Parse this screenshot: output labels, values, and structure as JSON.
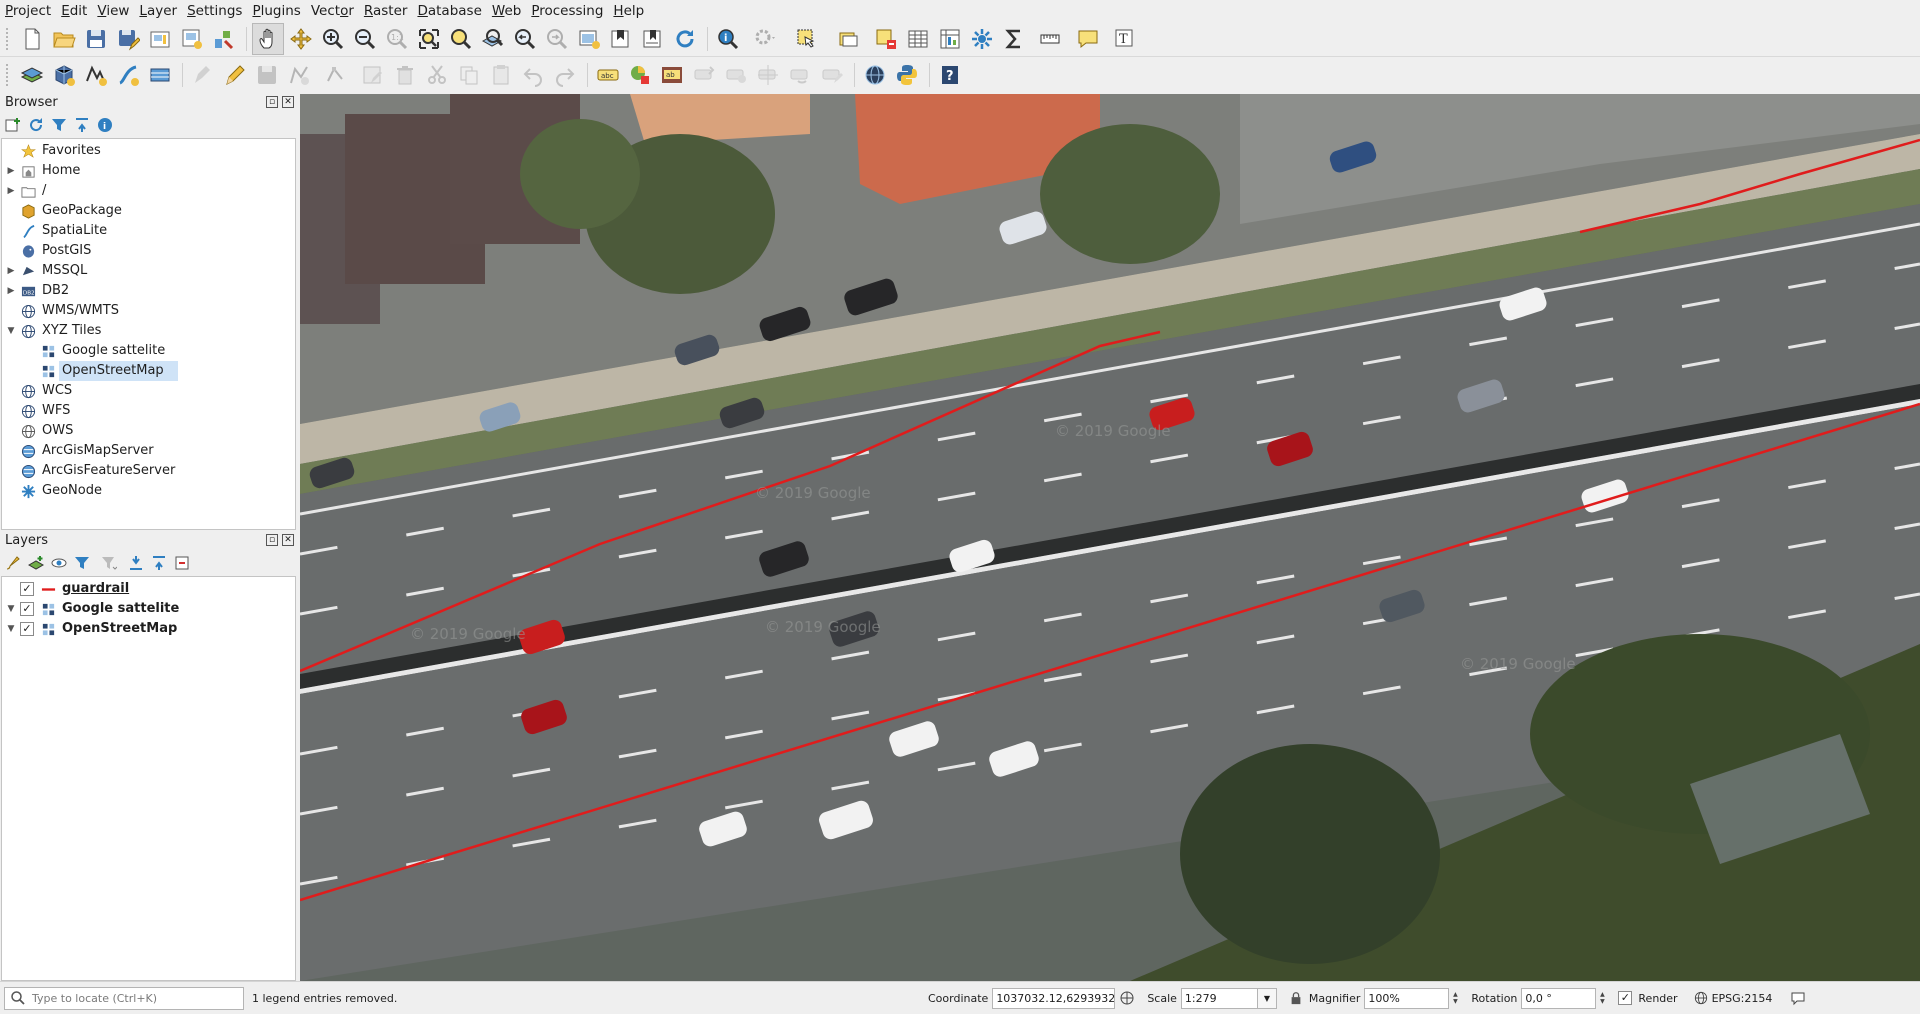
{
  "menu": [
    {
      "label": "Project",
      "key": "P"
    },
    {
      "label": "Edit",
      "key": "E"
    },
    {
      "label": "View",
      "key": "V"
    },
    {
      "label": "Layer",
      "key": "L"
    },
    {
      "label": "Settings",
      "key": "S"
    },
    {
      "label": "Plugins",
      "key": "P"
    },
    {
      "label": "Vector",
      "key": "o"
    },
    {
      "label": "Raster",
      "key": "R"
    },
    {
      "label": "Database",
      "key": "D"
    },
    {
      "label": "Web",
      "key": "W"
    },
    {
      "label": "Processing",
      "key": "P"
    },
    {
      "label": "Help",
      "key": "H"
    }
  ],
  "toolbar1": {
    "icons": [
      "new-project-icon",
      "open-project-icon",
      "save-project-icon",
      "save-as-icon",
      "new-print-layout-icon",
      "layout-manager-icon",
      "style-manager-icon",
      "pan-icon",
      "pan-to-selection-icon",
      "zoom-in-icon",
      "zoom-out-icon",
      "zoom-native-icon",
      "zoom-full-icon",
      "zoom-to-selection-icon",
      "zoom-to-layer-icon",
      "zoom-last-icon",
      "zoom-next-icon",
      "new-map-view-icon",
      "new-bookmark-icon",
      "show-bookmarks-icon",
      "refresh-icon",
      "identify-icon",
      "action-icon",
      "select-features-icon",
      "select-by-value-icon",
      "deselect-icon",
      "attribute-table-icon",
      "statistics-icon",
      "toolbox-icon",
      "sum-icon",
      "measure-icon",
      "map-tips-icon",
      "text-annotation-icon"
    ]
  },
  "toolbar2": {
    "icons": [
      "data-source-manager-icon",
      "new-geopackage-icon",
      "new-shapefile-icon",
      "new-spatialite-icon",
      "new-virtual-layer-icon",
      "current-edits-icon",
      "toggle-editing-icon",
      "save-edits-icon",
      "add-feature-icon",
      "vertex-tool-icon",
      "modify-attributes-icon",
      "delete-selected-icon",
      "cut-features-icon",
      "copy-features-icon",
      "paste-features-icon",
      "undo-icon",
      "redo-icon",
      "label-tool-icon",
      "diagram-icon",
      "label-highlight-icon",
      "pin-labels-icon",
      "show-hide-labels-icon",
      "move-label-icon",
      "rotate-label-icon",
      "change-label-icon",
      "globe-icon",
      "python-console-icon",
      "help-icon"
    ]
  },
  "browser": {
    "title": "Browser",
    "items": [
      {
        "label": "Favorites",
        "icon": "star-icon",
        "arrow": "",
        "indent": 0
      },
      {
        "label": "Home",
        "icon": "home-folder-icon",
        "arrow": "▶",
        "indent": 0
      },
      {
        "label": "/",
        "icon": "folder-icon",
        "arrow": "▶",
        "indent": 0
      },
      {
        "label": "GeoPackage",
        "icon": "geopackage-icon",
        "arrow": "",
        "indent": 0
      },
      {
        "label": "SpatiaLite",
        "icon": "spatialite-icon",
        "arrow": "",
        "indent": 0
      },
      {
        "label": "PostGIS",
        "icon": "postgis-icon",
        "arrow": "",
        "indent": 0
      },
      {
        "label": "MSSQL",
        "icon": "mssql-icon",
        "arrow": "▶",
        "indent": 0
      },
      {
        "label": "DB2",
        "icon": "db2-icon",
        "arrow": "▶",
        "indent": 0
      },
      {
        "label": "WMS/WMTS",
        "icon": "wms-icon",
        "arrow": "",
        "indent": 0
      },
      {
        "label": "XYZ Tiles",
        "icon": "xyz-tiles-icon",
        "arrow": "▼",
        "indent": 0
      },
      {
        "label": "Google sattelite",
        "icon": "raster-tile-icon",
        "arrow": "",
        "indent": 1
      },
      {
        "label": "OpenStreetMap",
        "icon": "raster-tile-icon",
        "arrow": "",
        "indent": 1,
        "selected": true
      },
      {
        "label": "WCS",
        "icon": "wcs-icon",
        "arrow": "",
        "indent": 0
      },
      {
        "label": "WFS",
        "icon": "wfs-icon",
        "arrow": "",
        "indent": 0
      },
      {
        "label": "OWS",
        "icon": "ows-icon",
        "arrow": "",
        "indent": 0
      },
      {
        "label": "ArcGisMapServer",
        "icon": "arcgis-map-icon",
        "arrow": "",
        "indent": 0
      },
      {
        "label": "ArcGisFeatureServer",
        "icon": "arcgis-feature-icon",
        "arrow": "",
        "indent": 0
      },
      {
        "label": "GeoNode",
        "icon": "geonode-icon",
        "arrow": "",
        "indent": 0
      }
    ]
  },
  "layers": {
    "title": "Layers",
    "items": [
      {
        "label": "guardrail",
        "icon": "line-symbol-icon",
        "arrow": "",
        "checked": true
      },
      {
        "label": "Google sattelite",
        "icon": "raster-tile-icon",
        "arrow": "▼",
        "checked": true
      },
      {
        "label": "OpenStreetMap",
        "icon": "raster-tile-icon",
        "arrow": "▼",
        "checked": true
      }
    ]
  },
  "map": {
    "watermarks": [
      "© 2019 Google",
      "© 2019 Google",
      "© 2019 Google",
      "© 2019 Google",
      "© 2019 Google"
    ],
    "guardrail_color": "#e01c1c"
  },
  "status": {
    "locate_placeholder": "Type to locate (Ctrl+K)",
    "message": "1 legend entries removed.",
    "coordinate_label": "Coordinate",
    "coordinate_value": "1037032.12,6293932.14",
    "scale_label": "Scale",
    "scale_value": "1:279",
    "magnifier_label": "Magnifier",
    "magnifier_value": "100%",
    "rotation_label": "Rotation",
    "rotation_value": "0,0 °",
    "render_label": "Render",
    "render_checked": true,
    "crs_label": "EPSG:2154"
  }
}
